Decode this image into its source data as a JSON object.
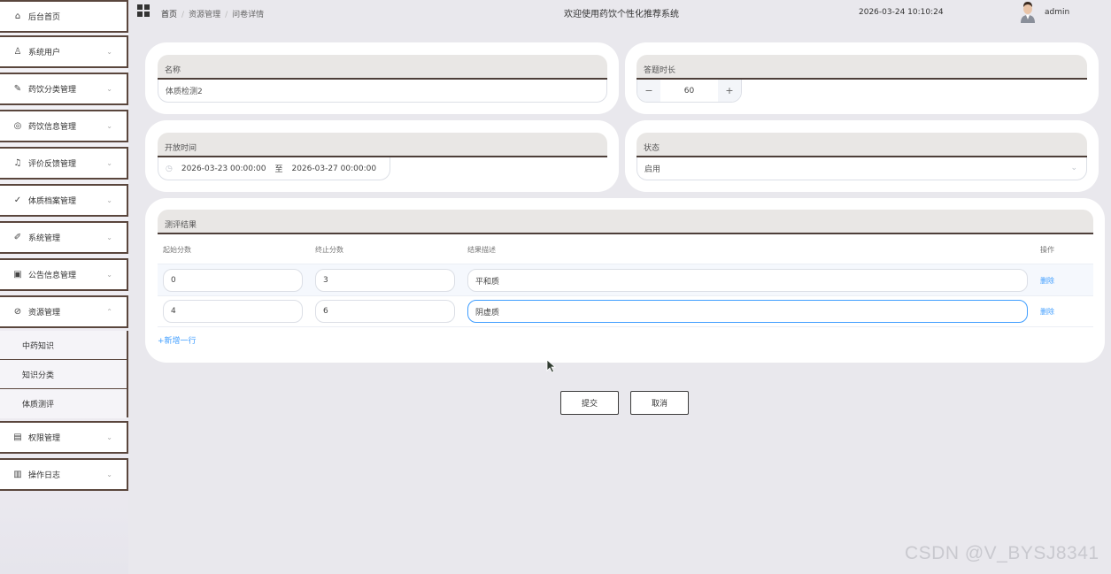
{
  "sidebar": {
    "items": [
      {
        "label": "后台首页",
        "icon": "home-icon",
        "glyph": "⌂"
      },
      {
        "label": "系统用户",
        "icon": "user-icon",
        "glyph": "♙"
      },
      {
        "label": "药饮分类管理",
        "icon": "edit-icon",
        "glyph": "✎"
      },
      {
        "label": "药饮信息管理",
        "icon": "disc-icon",
        "glyph": "◎"
      },
      {
        "label": "评价反馈管理",
        "icon": "bell-icon",
        "glyph": "♫"
      },
      {
        "label": "体质档案管理",
        "icon": "check-list-icon",
        "glyph": "✓"
      },
      {
        "label": "系统管理",
        "icon": "pen-icon",
        "glyph": "✐"
      },
      {
        "label": "公告信息管理",
        "icon": "notice-icon",
        "glyph": "▣"
      },
      {
        "label": "资源管理",
        "icon": "paperclip-icon",
        "glyph": "⊘"
      },
      {
        "label": "权限管理",
        "icon": "document-icon",
        "glyph": "▤"
      },
      {
        "label": "操作日志",
        "icon": "log-icon",
        "glyph": "▥"
      }
    ],
    "sub_items": [
      {
        "label": "中药知识"
      },
      {
        "label": "知识分类"
      },
      {
        "label": "体质测评"
      }
    ],
    "chevron_down": "⌄",
    "chevron_up": "⌃"
  },
  "topbar": {
    "breadcrumb": {
      "home": "首页",
      "level1": "资源管理",
      "level2": "问卷详情",
      "separator": "/"
    },
    "title": "欢迎使用药饮个性化推荐系统",
    "datetime": "2026-03-24 10:10:24",
    "username": "admin"
  },
  "form": {
    "name": {
      "label": "名称",
      "value": "体质检测2"
    },
    "duration": {
      "label": "答题时长",
      "value": "60",
      "minus": "−",
      "plus": "+"
    },
    "open_time": {
      "label": "开放时间",
      "start": "2026-03-23 00:00:00",
      "separator": "至",
      "end": "2026-03-27 00:00:00",
      "clock_glyph": "◷"
    },
    "status": {
      "label": "状态",
      "value": "启用",
      "arrow": "⌄"
    }
  },
  "results": {
    "label": "测评结果",
    "columns": {
      "start": "起始分数",
      "end": "终止分数",
      "desc": "结果描述",
      "action": "操作"
    },
    "rows": [
      {
        "start": "0",
        "end": "3",
        "desc": "平和质",
        "action": "删除"
      },
      {
        "start": "4",
        "end": "6",
        "desc": "阴虚质",
        "action": "删除"
      }
    ],
    "add_row": "+新增一行"
  },
  "actions": {
    "submit": "提交",
    "cancel": "取消"
  },
  "watermark": "CSDN @V_BYSJ8341",
  "colors": {
    "accent": "#409eff",
    "border_dark": "#5a463d",
    "background": "#e9e8ed"
  }
}
